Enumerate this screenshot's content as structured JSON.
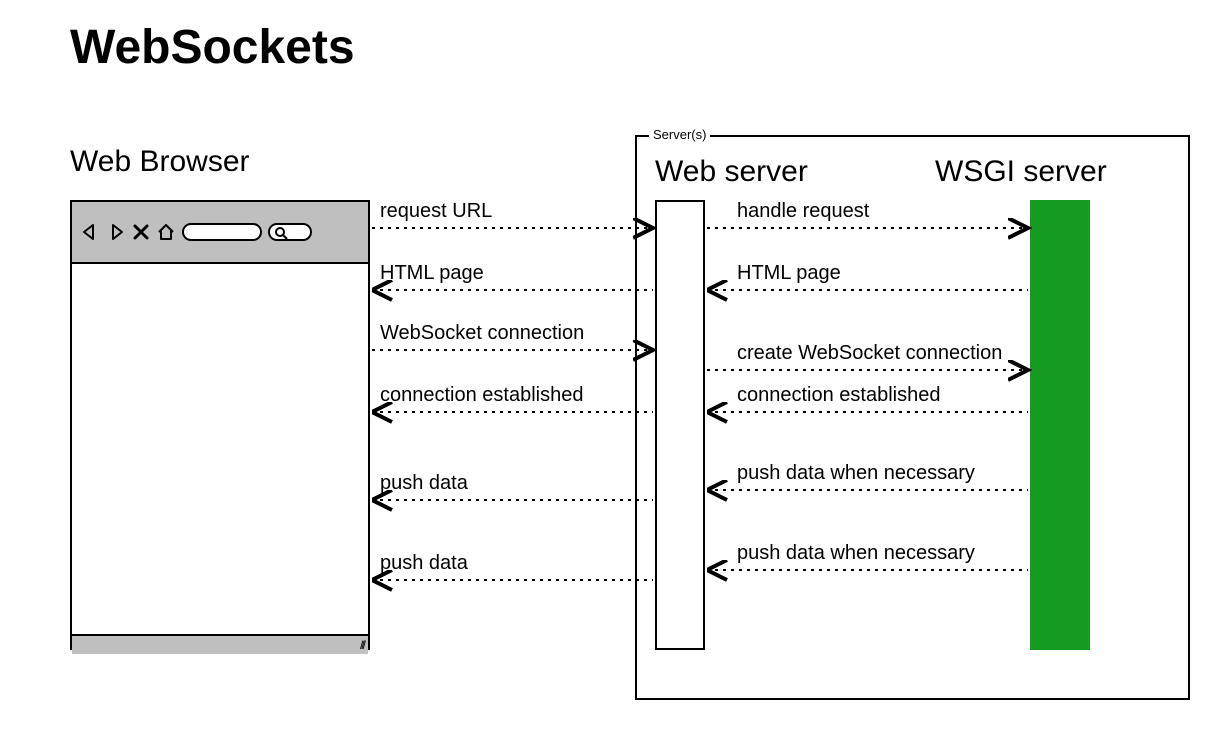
{
  "title": "WebSockets",
  "browser_title": "Web Browser",
  "servers_group_label": "Server(s)",
  "webserver_title": "Web server",
  "wsgi_title": "WSGI server",
  "icons": {
    "back": "back-arrow-icon",
    "forward": "forward-arrow-icon",
    "close": "close-icon",
    "home": "home-icon",
    "url_bar": "url-bar",
    "search_bar": "search-bar"
  },
  "flows": {
    "left": [
      {
        "label": "request URL",
        "dir": "right"
      },
      {
        "label": "HTML page",
        "dir": "left"
      },
      {
        "label": "WebSocket connection",
        "dir": "right"
      },
      {
        "label": "connection established",
        "dir": "left"
      },
      {
        "label": "push data",
        "dir": "left"
      },
      {
        "label": "push data",
        "dir": "left"
      }
    ],
    "right": [
      {
        "label": "handle request",
        "dir": "right"
      },
      {
        "label": "HTML page",
        "dir": "left"
      },
      {
        "label": "create WebSocket connection",
        "dir": "right"
      },
      {
        "label": "connection established",
        "dir": "left"
      },
      {
        "label": "push data when necessary",
        "dir": "left"
      },
      {
        "label": "push data when necessary",
        "dir": "left"
      }
    ]
  },
  "colors": {
    "wsgi_fill": "#159b20",
    "toolbar_fill": "#bfbfbf"
  }
}
